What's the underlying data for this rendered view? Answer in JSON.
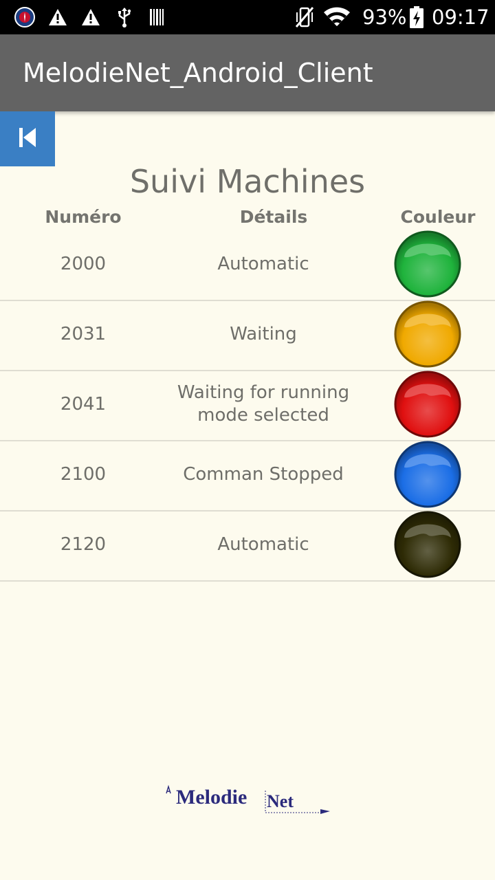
{
  "status_bar": {
    "battery": "93%",
    "time": "09:17",
    "icons": [
      "psg-badge-icon",
      "warning-icon",
      "warning-icon",
      "usb-icon",
      "barcode-icon",
      "vibrate-off-icon",
      "wifi-icon",
      "battery-charging-icon"
    ]
  },
  "app_bar": {
    "title": "MelodieNet_Android_Client"
  },
  "back_button": {
    "icon": "skip-back-icon"
  },
  "page": {
    "title": "Suivi Machines"
  },
  "table": {
    "headers": {
      "number": "Numéro",
      "details": "Détails",
      "color": "Couleur"
    },
    "rows": [
      {
        "number": "2000",
        "details": "Automatic",
        "color_name": "green",
        "color": "#1fb33c"
      },
      {
        "number": "2031",
        "details": "Waiting",
        "color_name": "orange",
        "color": "#f0a900"
      },
      {
        "number": "2041",
        "details": "Waiting for running mode selected",
        "color_name": "red",
        "color": "#e01010"
      },
      {
        "number": "2100",
        "details": "Comman Stopped",
        "color_name": "blue",
        "color": "#1b6ee6"
      },
      {
        "number": "2120",
        "details": "Automatic",
        "color_name": "dark-olive",
        "color": "#2e2b05"
      }
    ]
  },
  "footer": {
    "logo_text": "MelodieNet",
    "logo_part1": "Melodie",
    "logo_part2": "Net",
    "brand_color": "#2b2a7c"
  }
}
